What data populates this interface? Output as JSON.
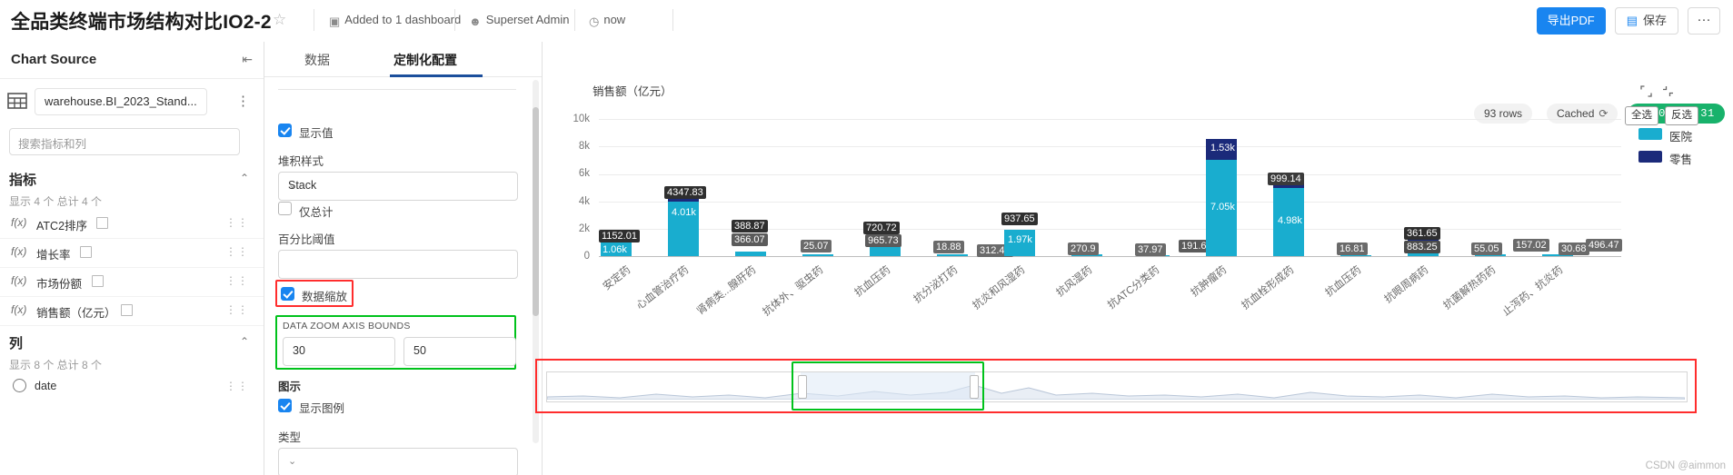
{
  "header": {
    "title": "全品类终端市场结构对比IO2-2",
    "star_icon": "star-icon",
    "dashboard_label": "Added to 1 dashboard",
    "dashboard_icon": "dashboard-icon",
    "owner_label": "Superset Admin",
    "owner_icon": "user-icon",
    "time_label": "now",
    "time_icon": "clock-icon",
    "export_pdf": "导出PDF",
    "save_label": "保存",
    "save_icon": "save-icon",
    "more_label": "···"
  },
  "left_panel": {
    "title": "Chart Source",
    "collapse_icon": "collapse-panel-icon",
    "dataset_name": "warehouse.BI_2023_Stand...",
    "dataset_icon": "table-icon",
    "dataset_more": "⋮",
    "search_placeholder": "搜索指标和列",
    "metrics": {
      "title": "指标",
      "subtitle": "显示 4 个 总计 4 个",
      "items": [
        {
          "name": "ATC2排序",
          "type": "fx",
          "has_tag": true
        },
        {
          "name": "增长率",
          "type": "fx",
          "has_tag": true
        },
        {
          "name": "市场份额",
          "type": "fx",
          "has_tag": true
        },
        {
          "name": "销售额（亿元）",
          "type": "fx",
          "has_tag": true
        }
      ]
    },
    "columns": {
      "title": "列",
      "subtitle": "显示 8 个 总计 8 个",
      "items": [
        {
          "name": "date",
          "type": "time"
        }
      ]
    }
  },
  "control_panel": {
    "tabs": [
      {
        "label": "数据",
        "active": false
      },
      {
        "label": "定制化配置",
        "active": true
      }
    ],
    "show_value": {
      "label": "显示值",
      "checked": true
    },
    "stack_style": {
      "label": "堆积样式",
      "value": "Stack"
    },
    "only_total": {
      "label": "仅总计",
      "checked": false
    },
    "percent_threshold": {
      "label": "百分比阈值",
      "value": ""
    },
    "data_zoom": {
      "label": "数据缩放",
      "checked": true
    },
    "zoom_bounds": {
      "label": "DATA ZOOM AXIS BOUNDS",
      "start": "30",
      "end": "50"
    },
    "legend_section": {
      "label": "图示"
    },
    "show_legend": {
      "label": "显示图例",
      "checked": true
    },
    "type_label": "类型"
  },
  "chart_panel": {
    "rows_badge": "93 rows",
    "cached_badge": "Cached",
    "cached_icon": "refresh-icon",
    "timer_badge": "00:00:00.31",
    "expand_icon": "expand-icon",
    "collapse_icon": "collapse-icon",
    "select_all": "全选",
    "invert_select": "反选",
    "legend": [
      {
        "label": "医院",
        "color": "#19adcf"
      },
      {
        "label": "零售",
        "color": "#1b2a7a"
      }
    ],
    "watermark": "CSDN @aimmon"
  },
  "chart_data": {
    "type": "bar",
    "title": "销售额（亿元）",
    "stacked": true,
    "ylabel": "销售额（亿元）",
    "xlabel": "",
    "ylim": [
      0,
      10000
    ],
    "yticks": [
      "0",
      "2k",
      "4k",
      "6k",
      "8k",
      "10k"
    ],
    "categories": [
      "安定药",
      "心血管治疗药",
      "肾病类...腺肝药",
      "抗体外、驱虫药",
      "抗血压药",
      "抗分泌打药",
      "抗炎和风湿药",
      "抗风湿药",
      "抗ATC分类药",
      "抗肿瘤药",
      "抗血栓形成药",
      "抗血压药",
      "抗眼周病药",
      "抗菌解热药药",
      "止泻药、抗炎药"
    ],
    "series": [
      {
        "name": "医院",
        "color": "#19adcf",
        "values": [
          1060,
          4010,
          366.07,
          25.07,
          965.73,
          18.88,
          1970,
          270.9,
          37.97,
          7050,
          4980,
          16.81,
          883.25,
          55.05,
          17.02
        ]
      },
      {
        "name": "零售",
        "color": "#1b2a7a",
        "values": [
          92.01,
          337.83,
          22.8,
          0,
          0,
          0,
          0,
          0,
          0,
          1530,
          999.14,
          0,
          361.65,
          0,
          0
        ]
      }
    ],
    "labels_total": [
      "1152.01",
      "4347.83",
      "388.87",
      "25.07",
      "720.72",
      "18.88",
      "937.65",
      "270.9",
      "37.97",
      "8580",
      "5979.14",
      "16.81",
      "1244.9",
      "55.05",
      "496.47"
    ],
    "visible_labels": [
      {
        "text": "1152.01",
        "kind": "total"
      },
      {
        "text": "1.06k",
        "kind": "segment"
      },
      {
        "text": "4347.83",
        "kind": "total"
      },
      {
        "text": "4.01k",
        "kind": "segment"
      },
      {
        "text": "388.87",
        "kind": "total"
      },
      {
        "text": "366.07",
        "kind": "segment"
      },
      {
        "text": "25.07",
        "kind": "total"
      },
      {
        "text": "720.72",
        "kind": "total"
      },
      {
        "text": "965.73",
        "kind": "segment"
      },
      {
        "text": "18.88",
        "kind": "total"
      },
      {
        "text": "312.47",
        "kind": "total"
      },
      {
        "text": "937.65",
        "kind": "total"
      },
      {
        "text": "1.97k",
        "kind": "segment"
      },
      {
        "text": "270.9",
        "kind": "total"
      },
      {
        "text": "37.97",
        "kind": "total"
      },
      {
        "text": "191.64",
        "kind": "total"
      },
      {
        "text": "1.53k",
        "kind": "segment"
      },
      {
        "text": "7.05k",
        "kind": "segment"
      },
      {
        "text": "999.14",
        "kind": "total"
      },
      {
        "text": "4.98k",
        "kind": "segment"
      },
      {
        "text": "16.81",
        "kind": "total"
      },
      {
        "text": "361.65",
        "kind": "total"
      },
      {
        "text": "883.25",
        "kind": "segment"
      },
      {
        "text": "55.05",
        "kind": "total"
      },
      {
        "text": "157.02",
        "kind": "total"
      },
      {
        "text": "30.68",
        "kind": "total"
      },
      {
        "text": "496.47",
        "kind": "total"
      }
    ]
  }
}
